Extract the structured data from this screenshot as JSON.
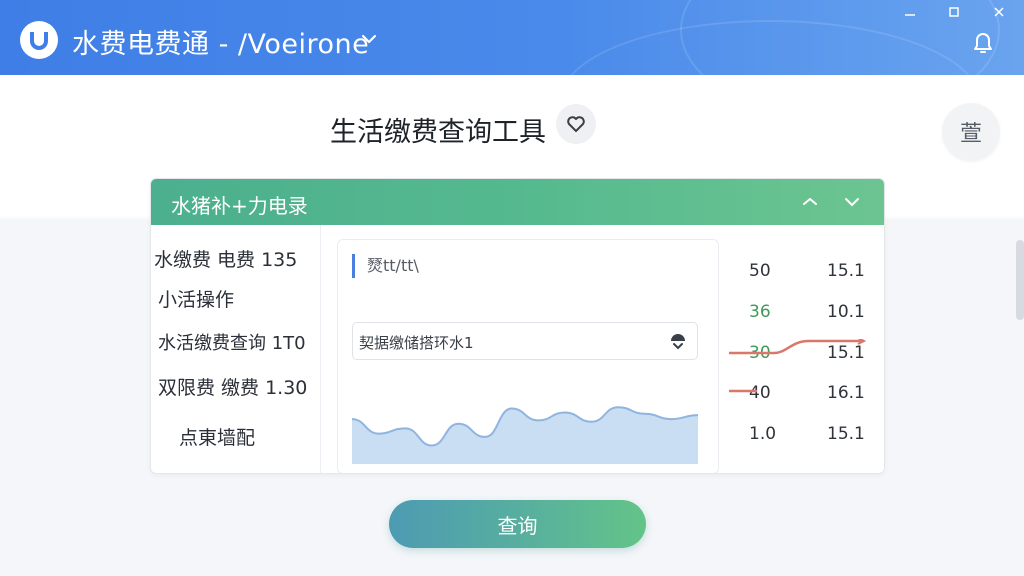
{
  "window": {
    "title": "水费电费通 - /Voeirone",
    "controls": {
      "minimize": "–",
      "maximize": "□",
      "close": "✕"
    },
    "colors": {
      "titlebar": "#4a8aea",
      "accent_green": "#55b98f"
    }
  },
  "header": {
    "page_title": "生活缴费查询工具",
    "login_label": "萱"
  },
  "card": {
    "title": "水猪补+力电录",
    "left_items": [
      "水缴费 电费 135",
      "小活操作",
      "水活缴费查询 1T0",
      "双限费 缴费 1.30",
      "点東墙配"
    ],
    "panel": {
      "label": "燹tt/tt\\",
      "select_value": "契据缴储搭环水1"
    },
    "values_col1": [
      "50",
      "36",
      "30",
      "40",
      "1.0"
    ],
    "values_col2": [
      "15.1",
      "10.1",
      "15.1",
      "16.1",
      "15.1"
    ],
    "series": [
      0.62,
      0.4,
      0.48,
      0.22,
      0.55,
      0.35,
      0.78,
      0.6,
      0.72,
      0.58,
      0.8,
      0.7,
      0.62,
      0.68
    ]
  },
  "actions": {
    "query_label": "查询"
  },
  "icons": {
    "logo": "u-logo-icon",
    "chevron": "chevron-down-icon",
    "bell": "bell-icon",
    "heart": "heart-icon",
    "collapse": "chevron-up-icon",
    "expand": "chevron-down-icon",
    "select": "dropdown-icon"
  }
}
